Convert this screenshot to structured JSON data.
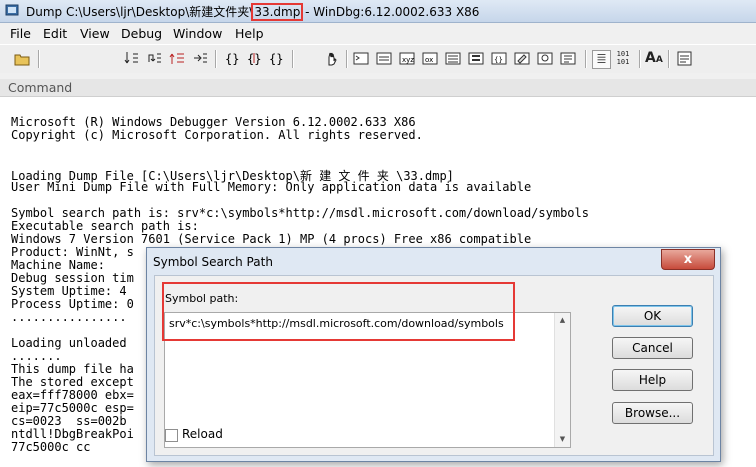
{
  "window": {
    "title_prefix": "Dump C:\\Users\\ljr\\Desktop\\新建文件夹\\",
    "title_highlight": "33.dmp",
    "title_suffix": " - WinDbg:6.12.0002.633 X86"
  },
  "menu": [
    "File",
    "Edit",
    "View",
    "Debug",
    "Window",
    "Help"
  ],
  "toolbar": {
    "font_size_label": "A",
    "font_size_sub": "A",
    "hex_label_top": "101",
    "hex_label_bottom": "101"
  },
  "panel": {
    "label": "Command"
  },
  "console": {
    "lines": [
      "Microsoft (R) Windows Debugger Version 6.12.0002.633 X86",
      "Copyright (c) Microsoft Corporation. All rights reserved.",
      "",
      "",
      "Loading Dump File [C:\\Users\\ljr\\Desktop\\新 建 文 件 夹 \\33.dmp]",
      "User Mini Dump File with Full Memory: Only application data is available",
      "",
      "Symbol search path is: srv*c:\\symbols*http://msdl.microsoft.com/download/symbols",
      "Executable search path is:",
      "Windows 7 Version 7601 (Service Pack 1) MP (4 procs) Free x86 compatible",
      "Product: WinNt, s",
      "Machine Name:",
      "Debug session tim",
      "System Uptime: 4",
      "Process Uptime: 0",
      "................",
      "",
      "Loading unloaded",
      ".......",
      "This dump file ha",
      "The stored except",
      "eax=fff78000 ebx=",
      "eip=77c5000c esp=",
      "cs=0023  ss=002b",
      "ntdll!DbgBreakPoi",
      "77c5000c cc"
    ]
  },
  "dialog": {
    "title": "Symbol Search Path",
    "close_glyph": "x",
    "symbol_path_label": "Symbol path:",
    "symbol_path_value": "srv*c:\\symbols*http://msdl.microsoft.com/download/symbols",
    "ok_label": "OK",
    "cancel_label": "Cancel",
    "help_label": "Help",
    "browse_label": "Browse...",
    "reload_label": "Reload",
    "reload_checked": false
  },
  "colors": {
    "highlight": "#e53935",
    "dialog_frame": "#dfe8f3"
  }
}
